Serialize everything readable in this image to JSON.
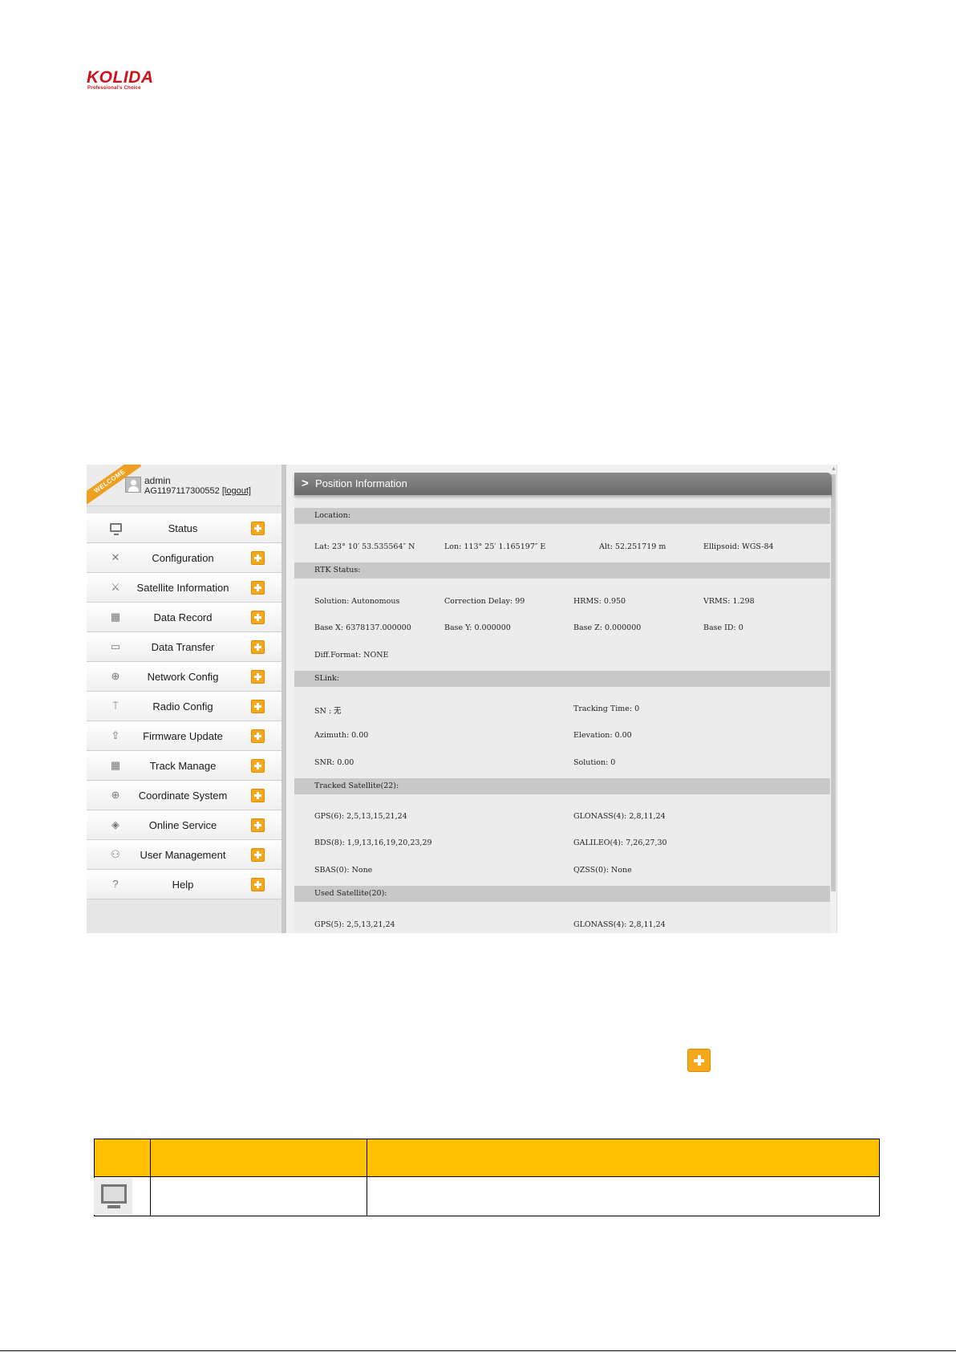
{
  "logo": {
    "text": "KOLIDA",
    "tagline": "Professional's Choice"
  },
  "user": {
    "ribbon": "WELCOME",
    "name": "admin",
    "serial": "AG1197117300552",
    "logout_label": "[logout]"
  },
  "menu": [
    {
      "label": "Status",
      "icon": "monitor-icon"
    },
    {
      "label": "Configuration",
      "icon": "tools-icon"
    },
    {
      "label": "Satellite Information",
      "icon": "satellite-icon"
    },
    {
      "label": "Data Record",
      "icon": "calendar-icon"
    },
    {
      "label": "Data Transfer",
      "icon": "network-computer-icon"
    },
    {
      "label": "Network Config",
      "icon": "globe-icon"
    },
    {
      "label": "Radio Config",
      "icon": "antenna-icon"
    },
    {
      "label": "Firmware Update",
      "icon": "upload-icon"
    },
    {
      "label": "Track Manage",
      "icon": "calendar-icon"
    },
    {
      "label": "Coordinate System",
      "icon": "globe-icon"
    },
    {
      "label": "Online Service",
      "icon": "cube-icon"
    },
    {
      "label": "User Management",
      "icon": "users-icon"
    },
    {
      "label": "Help",
      "icon": "question-icon"
    }
  ],
  "panel": {
    "title": "Position Information",
    "location": {
      "heading": "Location:",
      "lat": "Lat: 23° 10′ 53.535564″ N",
      "lon": "Lon: 113° 25′ 1.165197″ E",
      "alt": "Alt: 52.251719 m",
      "ellipsoid": "Ellipsoid: WGS-84"
    },
    "rtk": {
      "heading": "RTK Status:",
      "solution": "Solution: Autonomous",
      "correction_delay": "Correction Delay: 99",
      "hrms": "HRMS: 0.950",
      "vrms": "VRMS: 1.298",
      "base_x": "Base X: 6378137.000000",
      "base_y": "Base Y: 0.000000",
      "base_z": "Base Z: 0.000000",
      "base_id": "Base ID: 0",
      "diff_format": "Diff.Format: NONE"
    },
    "slink": {
      "heading": "SLink:",
      "sn": "SN : 无",
      "tracking_time": "Tracking Time: 0",
      "azimuth": "Azimuth: 0.00",
      "elevation": "Elevation: 0.00",
      "snr": "SNR: 0.00",
      "solution": "Solution: 0"
    },
    "tracked": {
      "heading": "Tracked Satellite(22):",
      "gps": "GPS(6): 2,5,13,15,21,24",
      "glonass": "GLONASS(4): 2,8,11,24",
      "bds": "BDS(8): 1,9,13,16,19,20,23,29",
      "galileo": "GALILEO(4): 7,26,27,30",
      "sbas": "SBAS(0): None",
      "qzss": "QZSS(0): None"
    },
    "used": {
      "heading": "Used Satellite(20):",
      "gps": "GPS(5): 2,5,13,21,24",
      "glonass": "GLONASS(4): 2,8,11,24"
    }
  },
  "colors": {
    "accent": "#f5a81c",
    "table_header": "#ffc000",
    "logo_red": "#d0121b"
  }
}
